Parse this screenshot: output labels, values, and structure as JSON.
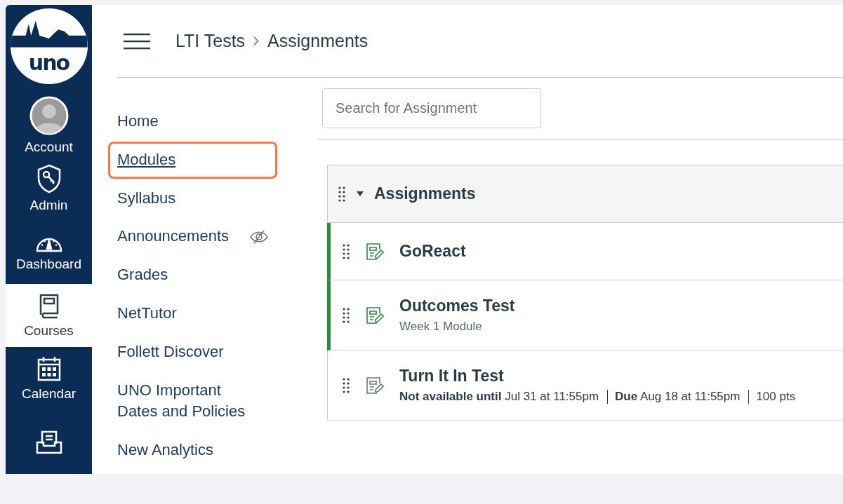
{
  "global_nav": {
    "logo_text": "uno",
    "items": [
      {
        "label": "Account",
        "kind": "avatar",
        "selected": false
      },
      {
        "label": "Admin",
        "kind": "admin",
        "selected": false
      },
      {
        "label": "Dashboard",
        "kind": "dashboard",
        "selected": false
      },
      {
        "label": "Courses",
        "kind": "courses",
        "selected": true
      },
      {
        "label": "Calendar",
        "kind": "calendar",
        "selected": false
      },
      {
        "kind": "inbox",
        "selected": false
      }
    ]
  },
  "breadcrumb": [
    "LTI Tests",
    "Assignments"
  ],
  "course_nav": [
    {
      "label": "Home",
      "highlighted": false,
      "hidden": false
    },
    {
      "label": "Modules",
      "highlighted": true,
      "hidden": false
    },
    {
      "label": "Syllabus",
      "highlighted": false,
      "hidden": false
    },
    {
      "label": "Announcements",
      "highlighted": false,
      "hidden": true
    },
    {
      "label": "Grades",
      "highlighted": false,
      "hidden": false
    },
    {
      "label": "NetTutor",
      "highlighted": false,
      "hidden": false
    },
    {
      "label": "Follett Discover",
      "highlighted": false,
      "hidden": false
    },
    {
      "label": "UNO Important Dates and Policies",
      "highlighted": false,
      "hidden": false
    },
    {
      "label": "New Analytics",
      "highlighted": false,
      "hidden": false
    }
  ],
  "search": {
    "placeholder": "Search for Assignment"
  },
  "assignment_group": {
    "title": "Assignments",
    "expanded": true,
    "items": [
      {
        "title": "GoReact",
        "published": true
      },
      {
        "title": "Outcomes Test",
        "published": true,
        "details": [
          "Week 1 Module"
        ]
      },
      {
        "title": "Turn It In Test",
        "published": false,
        "details": [
          "**Not available until** Jul 31 at 11:55pm",
          "**Due** Aug 18 at 11:55pm",
          "100 pts"
        ]
      }
    ]
  }
}
